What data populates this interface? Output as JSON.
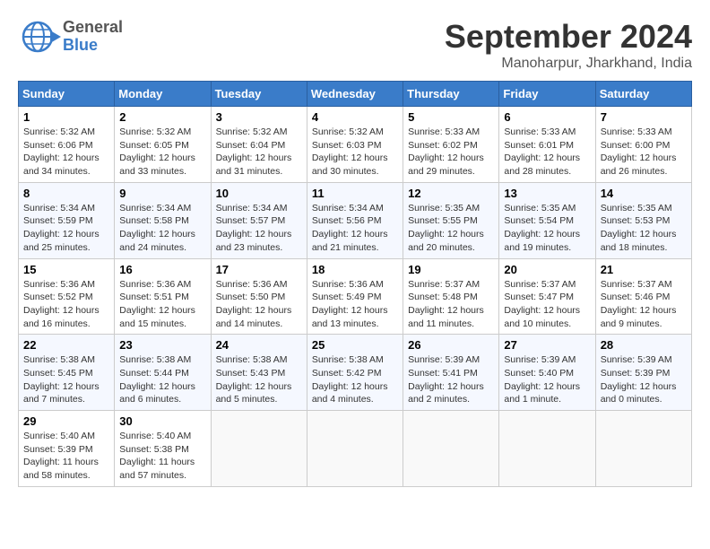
{
  "header": {
    "logo_general": "General",
    "logo_blue": "Blue",
    "month_title": "September 2024",
    "location": "Manoharpur, Jharkhand, India"
  },
  "calendar": {
    "days_of_week": [
      "Sunday",
      "Monday",
      "Tuesday",
      "Wednesday",
      "Thursday",
      "Friday",
      "Saturday"
    ],
    "weeks": [
      [
        {
          "day": "",
          "info": ""
        },
        {
          "day": "2",
          "info": "Sunrise: 5:32 AM\nSunset: 6:05 PM\nDaylight: 12 hours\nand 33 minutes."
        },
        {
          "day": "3",
          "info": "Sunrise: 5:32 AM\nSunset: 6:04 PM\nDaylight: 12 hours\nand 31 minutes."
        },
        {
          "day": "4",
          "info": "Sunrise: 5:32 AM\nSunset: 6:03 PM\nDaylight: 12 hours\nand 30 minutes."
        },
        {
          "day": "5",
          "info": "Sunrise: 5:33 AM\nSunset: 6:02 PM\nDaylight: 12 hours\nand 29 minutes."
        },
        {
          "day": "6",
          "info": "Sunrise: 5:33 AM\nSunset: 6:01 PM\nDaylight: 12 hours\nand 28 minutes."
        },
        {
          "day": "7",
          "info": "Sunrise: 5:33 AM\nSunset: 6:00 PM\nDaylight: 12 hours\nand 26 minutes."
        }
      ],
      [
        {
          "day": "1",
          "info": "Sunrise: 5:32 AM\nSunset: 6:06 PM\nDaylight: 12 hours\nand 34 minutes."
        },
        {
          "day": "8",
          "info": "Sunrise: 5:34 AM\nSunset: 5:59 PM\nDaylight: 12 hours\nand 25 minutes."
        },
        {
          "day": "9",
          "info": "Sunrise: 5:34 AM\nSunset: 5:58 PM\nDaylight: 12 hours\nand 24 minutes."
        },
        {
          "day": "10",
          "info": "Sunrise: 5:34 AM\nSunset: 5:57 PM\nDaylight: 12 hours\nand 23 minutes."
        },
        {
          "day": "11",
          "info": "Sunrise: 5:34 AM\nSunset: 5:56 PM\nDaylight: 12 hours\nand 21 minutes."
        },
        {
          "day": "12",
          "info": "Sunrise: 5:35 AM\nSunset: 5:55 PM\nDaylight: 12 hours\nand 20 minutes."
        },
        {
          "day": "13",
          "info": "Sunrise: 5:35 AM\nSunset: 5:54 PM\nDaylight: 12 hours\nand 19 minutes."
        },
        {
          "day": "14",
          "info": "Sunrise: 5:35 AM\nSunset: 5:53 PM\nDaylight: 12 hours\nand 18 minutes."
        }
      ],
      [
        {
          "day": "15",
          "info": "Sunrise: 5:36 AM\nSunset: 5:52 PM\nDaylight: 12 hours\nand 16 minutes."
        },
        {
          "day": "16",
          "info": "Sunrise: 5:36 AM\nSunset: 5:51 PM\nDaylight: 12 hours\nand 15 minutes."
        },
        {
          "day": "17",
          "info": "Sunrise: 5:36 AM\nSunset: 5:50 PM\nDaylight: 12 hours\nand 14 minutes."
        },
        {
          "day": "18",
          "info": "Sunrise: 5:36 AM\nSunset: 5:49 PM\nDaylight: 12 hours\nand 13 minutes."
        },
        {
          "day": "19",
          "info": "Sunrise: 5:37 AM\nSunset: 5:48 PM\nDaylight: 12 hours\nand 11 minutes."
        },
        {
          "day": "20",
          "info": "Sunrise: 5:37 AM\nSunset: 5:47 PM\nDaylight: 12 hours\nand 10 minutes."
        },
        {
          "day": "21",
          "info": "Sunrise: 5:37 AM\nSunset: 5:46 PM\nDaylight: 12 hours\nand 9 minutes."
        }
      ],
      [
        {
          "day": "22",
          "info": "Sunrise: 5:38 AM\nSunset: 5:45 PM\nDaylight: 12 hours\nand 7 minutes."
        },
        {
          "day": "23",
          "info": "Sunrise: 5:38 AM\nSunset: 5:44 PM\nDaylight: 12 hours\nand 6 minutes."
        },
        {
          "day": "24",
          "info": "Sunrise: 5:38 AM\nSunset: 5:43 PM\nDaylight: 12 hours\nand 5 minutes."
        },
        {
          "day": "25",
          "info": "Sunrise: 5:38 AM\nSunset: 5:42 PM\nDaylight: 12 hours\nand 4 minutes."
        },
        {
          "day": "26",
          "info": "Sunrise: 5:39 AM\nSunset: 5:41 PM\nDaylight: 12 hours\nand 2 minutes."
        },
        {
          "day": "27",
          "info": "Sunrise: 5:39 AM\nSunset: 5:40 PM\nDaylight: 12 hours\nand 1 minute."
        },
        {
          "day": "28",
          "info": "Sunrise: 5:39 AM\nSunset: 5:39 PM\nDaylight: 12 hours\nand 0 minutes."
        }
      ],
      [
        {
          "day": "29",
          "info": "Sunrise: 5:40 AM\nSunset: 5:39 PM\nDaylight: 11 hours\nand 58 minutes."
        },
        {
          "day": "30",
          "info": "Sunrise: 5:40 AM\nSunset: 5:38 PM\nDaylight: 11 hours\nand 57 minutes."
        },
        {
          "day": "",
          "info": ""
        },
        {
          "day": "",
          "info": ""
        },
        {
          "day": "",
          "info": ""
        },
        {
          "day": "",
          "info": ""
        },
        {
          "day": "",
          "info": ""
        }
      ]
    ]
  }
}
